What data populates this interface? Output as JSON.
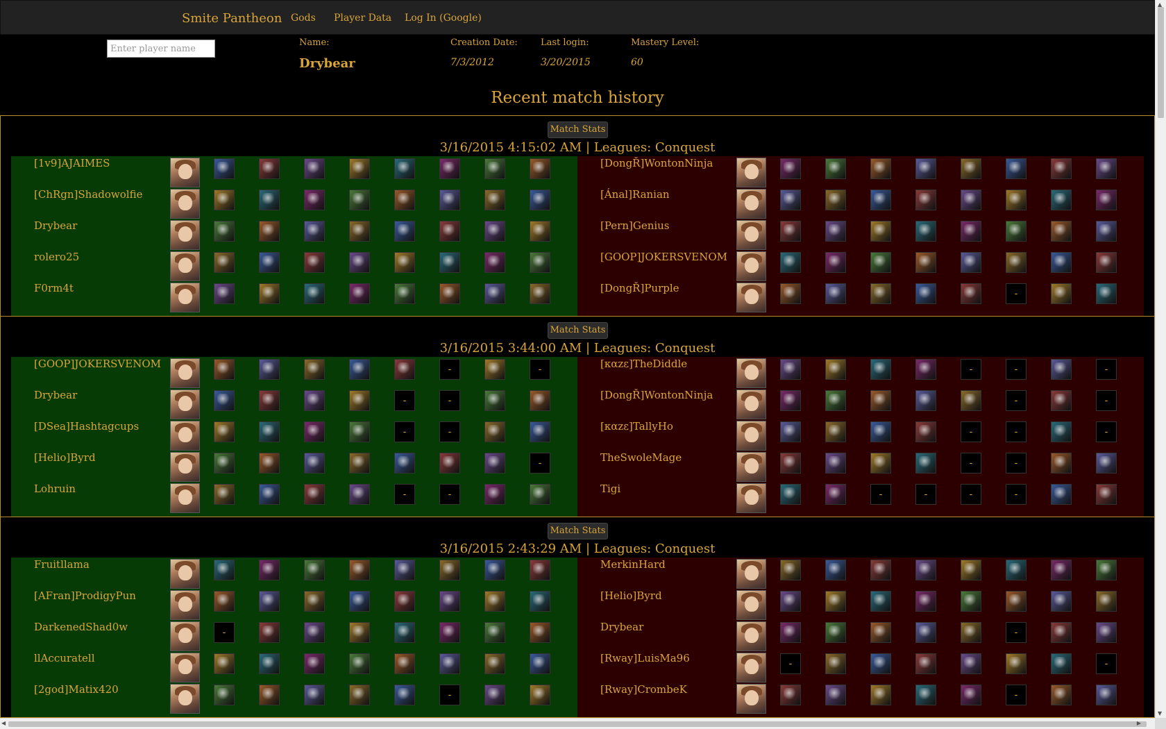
{
  "nav": {
    "brand": "Smite Pantheon",
    "links": [
      "Gods",
      "Player Data",
      "Log In (Google)"
    ]
  },
  "search": {
    "placeholder": "Enter player name"
  },
  "player": {
    "name_label": "Name:",
    "name": "Drybear",
    "creation_label": "Creation Date:",
    "creation": "7/3/2012",
    "login_label": "Last login:",
    "login": "3/20/2015",
    "mastery_label": "Mastery Level:",
    "mastery": "60"
  },
  "section_title": "Recent match history",
  "match_stats_label": "Match Stats",
  "colors": {
    "win_team": "#063b06",
    "lose_team": "#2c0000",
    "text": "#d9a53a"
  },
  "matches": [
    {
      "header": "3/16/2015 4:15:02 AM | Leagues: Conquest",
      "winners": [
        {
          "name": "[1v9]AJAIMES",
          "items": [
            "I",
            "I",
            "I",
            "I",
            "I",
            "I",
            "I",
            "I"
          ]
        },
        {
          "name": "[ChRgn]Shadowolfie",
          "items": [
            "I",
            "I",
            "I",
            "I",
            "I",
            "I",
            "I",
            "I"
          ]
        },
        {
          "name": "Drybear",
          "items": [
            "I",
            "I",
            "I",
            "I",
            "I",
            "I",
            "I",
            "I"
          ]
        },
        {
          "name": "rolero25",
          "items": [
            "I",
            "I",
            "I",
            "I",
            "I",
            "I",
            "I",
            "I"
          ]
        },
        {
          "name": "F0rm4t",
          "items": [
            "I",
            "I",
            "I",
            "I",
            "I",
            "I",
            "I",
            "I"
          ]
        }
      ],
      "losers": [
        {
          "name": "[DongŘ]WontonNinja",
          "items": [
            "I",
            "I",
            "I",
            "I",
            "I",
            "I",
            "I",
            "I"
          ]
        },
        {
          "name": "[Ánal]Ranian",
          "items": [
            "I",
            "I",
            "I",
            "I",
            "I",
            "I",
            "I",
            "I"
          ]
        },
        {
          "name": "[Pern]Genius",
          "items": [
            "I",
            "I",
            "I",
            "I",
            "I",
            "I",
            "I",
            "I"
          ]
        },
        {
          "name": "[GOOP]JOKERSVENOM",
          "items": [
            "I",
            "I",
            "I",
            "I",
            "I",
            "I",
            "I",
            "I"
          ]
        },
        {
          "name": "[DongŘ]Purple",
          "items": [
            "I",
            "I",
            "I",
            "I",
            "I",
            "-",
            "I",
            "I"
          ]
        }
      ]
    },
    {
      "header": "3/16/2015 3:44:00 AM | Leagues: Conquest",
      "winners": [
        {
          "name": "[GOOP]JOKERSVENOM",
          "items": [
            "I",
            "I",
            "I",
            "I",
            "I",
            "-",
            "I",
            "-"
          ]
        },
        {
          "name": "Drybear",
          "items": [
            "I",
            "I",
            "I",
            "I",
            "-",
            "-",
            "I",
            "I"
          ]
        },
        {
          "name": "[DSea]Hashtagcups",
          "items": [
            "I",
            "I",
            "I",
            "I",
            "-",
            "-",
            "I",
            "I"
          ]
        },
        {
          "name": "[Helio]Byrd",
          "items": [
            "I",
            "I",
            "I",
            "I",
            "I",
            "I",
            "I",
            "-"
          ]
        },
        {
          "name": "Lohruin",
          "items": [
            "I",
            "I",
            "I",
            "I",
            "-",
            "-",
            "I",
            "I"
          ]
        }
      ],
      "losers": [
        {
          "name": "[καzε]TheDiddle",
          "items": [
            "I",
            "I",
            "I",
            "I",
            "-",
            "-",
            "I",
            "-"
          ]
        },
        {
          "name": "[DongŘ]WontonNinja",
          "items": [
            "I",
            "I",
            "I",
            "I",
            "I",
            "-",
            "I",
            "-"
          ]
        },
        {
          "name": "[καzε]TallyHo",
          "items": [
            "I",
            "I",
            "I",
            "I",
            "-",
            "-",
            "I",
            "-"
          ]
        },
        {
          "name": "TheSwoleMage",
          "items": [
            "I",
            "I",
            "I",
            "I",
            "-",
            "-",
            "I",
            "I"
          ]
        },
        {
          "name": "Tigi",
          "items": [
            "I",
            "I",
            "-",
            "-",
            "-",
            "-",
            "I",
            "I"
          ]
        }
      ]
    },
    {
      "header": "3/16/2015 2:43:29 AM | Leagues: Conquest",
      "winners": [
        {
          "name": "Fruitllama",
          "items": [
            "I",
            "I",
            "I",
            "I",
            "I",
            "I",
            "I",
            "I"
          ]
        },
        {
          "name": "[AFran]ProdigyPun",
          "items": [
            "I",
            "I",
            "I",
            "I",
            "I",
            "I",
            "I",
            "I"
          ]
        },
        {
          "name": "DarkenedShad0w",
          "items": [
            "-",
            "I",
            "I",
            "I",
            "I",
            "I",
            "I",
            "I"
          ]
        },
        {
          "name": "llAccuratell",
          "items": [
            "I",
            "I",
            "I",
            "I",
            "I",
            "I",
            "I",
            "I"
          ]
        },
        {
          "name": "[2god]Matix420",
          "items": [
            "I",
            "I",
            "I",
            "I",
            "I",
            "-",
            "I",
            "I"
          ]
        }
      ],
      "losers": [
        {
          "name": "MerkinHard",
          "items": [
            "I",
            "I",
            "I",
            "I",
            "I",
            "I",
            "I",
            "I"
          ]
        },
        {
          "name": "[Helio]Byrd",
          "items": [
            "I",
            "I",
            "I",
            "I",
            "I",
            "I",
            "I",
            "I"
          ]
        },
        {
          "name": "Drybear",
          "items": [
            "I",
            "I",
            "I",
            "I",
            "I",
            "-",
            "I",
            "I"
          ]
        },
        {
          "name": "[Rway]LuisMa96",
          "items": [
            "-",
            "I",
            "I",
            "I",
            "I",
            "I",
            "I",
            "-"
          ]
        },
        {
          "name": "[Rway]CrombeK",
          "items": [
            "I",
            "I",
            "I",
            "I",
            "I",
            "-",
            "I",
            "I"
          ]
        }
      ]
    }
  ]
}
